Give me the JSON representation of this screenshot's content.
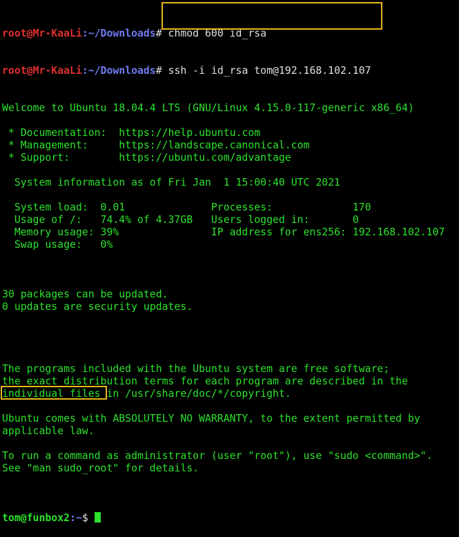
{
  "prompt1": {
    "user_host": "root@Mr-KaaLi",
    "path": ":~/Downloads",
    "symbol": "#",
    "command": " chmod 600 id_rsa"
  },
  "prompt2": {
    "user_host": "root@Mr-KaaLi",
    "path": ":~/Downloads",
    "symbol": "#",
    "command": " ssh -i id_rsa tom@192.168.102.107"
  },
  "output_lines": [
    "Welcome to Ubuntu 18.04.4 LTS (GNU/Linux 4.15.0-117-generic x86_64)",
    "",
    " * Documentation:  https://help.ubuntu.com",
    " * Management:     https://landscape.canonical.com",
    " * Support:        https://ubuntu.com/advantage",
    "",
    "  System information as of Fri Jan  1 15:00:40 UTC 2021",
    "",
    "  System load:  0.01              Processes:             170",
    "  Usage of /:   74.4% of 4.37GB   Users logged in:       0",
    "  Memory usage: 39%               IP address for ens256: 192.168.102.107",
    "  Swap usage:   0%",
    "",
    "",
    "",
    "30 packages can be updated.",
    "0 updates are security updates.",
    "",
    "",
    "",
    "",
    "The programs included with the Ubuntu system are free software;",
    "the exact distribution terms for each program are described in the",
    "individual files in /usr/share/doc/*/copyright.",
    "",
    "Ubuntu comes with ABSOLUTELY NO WARRANTY, to the extent permitted by",
    "applicable law.",
    "",
    "To run a command as administrator (user \"root\"), use \"sudo <command>\".",
    "See \"man sudo_root\" for details.",
    ""
  ],
  "prompt3": {
    "user_host": "tom@funbox2",
    "path": ":~",
    "symbol": "$ "
  },
  "colors": {
    "background": "#000000",
    "text_green": "#2de12d",
    "root_red": "#e03030",
    "path_blue": "#6f7cf0",
    "highlight_yellow": "#e5b81a"
  }
}
